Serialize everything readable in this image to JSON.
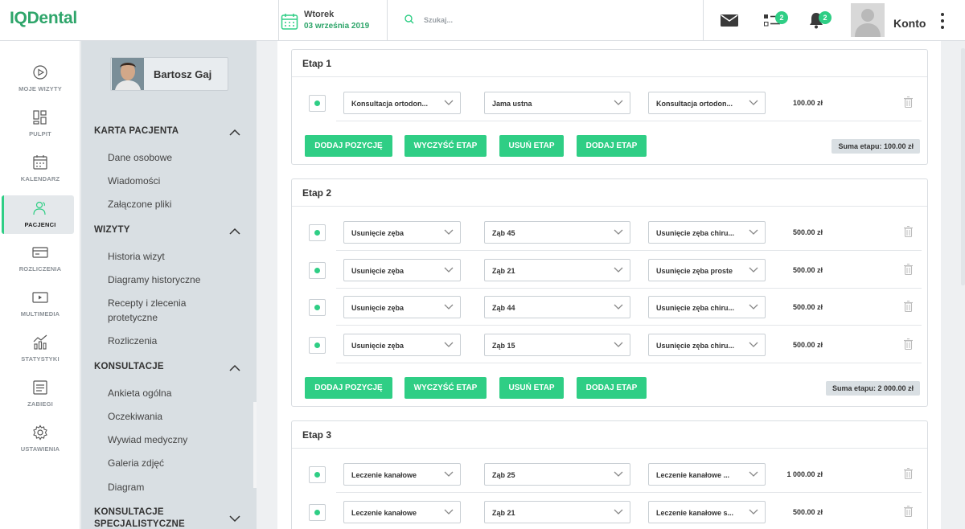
{
  "app": {
    "logo": "IQDental"
  },
  "header": {
    "day": "Wtorek",
    "date": "03 września 2019",
    "search_placeholder": "Szukaj...",
    "tasks_badge": "2",
    "notifications_badge": "2",
    "account_label": "Konto"
  },
  "nav": [
    {
      "label": "MOJE WIZYTY",
      "icon": "play-circle-icon"
    },
    {
      "label": "PULPIT",
      "icon": "dashboard-icon"
    },
    {
      "label": "KALENDARZ",
      "icon": "calendar-icon"
    },
    {
      "label": "PACJENCI",
      "icon": "patients-icon",
      "active": true
    },
    {
      "label": "ROZLICZENIA",
      "icon": "card-icon"
    },
    {
      "label": "MULTIMEDIA",
      "icon": "media-icon"
    },
    {
      "label": "STATYSTYKI",
      "icon": "stats-icon"
    },
    {
      "label": "ZABIEGI",
      "icon": "procedures-icon"
    },
    {
      "label": "USTAWIENIA",
      "icon": "settings-icon"
    }
  ],
  "patient": {
    "name": "Bartosz Gaj",
    "sections": [
      {
        "title": "KARTA PACJENTA",
        "expanded": true,
        "items": [
          "Dane osobowe",
          "Wiadomości",
          "Załączone pliki"
        ]
      },
      {
        "title": "WIZYTY",
        "expanded": true,
        "items": [
          "Historia wizyt",
          "Diagramy historyczne",
          "Recepty i zlecenia",
          "protetyczne",
          "Rozliczenia"
        ]
      },
      {
        "title": "KONSULTACJE",
        "expanded": true,
        "items": [
          "Ankieta ogólna",
          "Oczekiwania",
          "Wywiad medyczny",
          "Galeria zdjęć",
          "Diagram"
        ]
      },
      {
        "title": "KONSULTACJE",
        "title2": "SPECJALISTYCZNE",
        "expanded": false,
        "items": []
      }
    ]
  },
  "buttons": {
    "add_position": "DODAJ POZYCJĘ",
    "clear_stage": "WYCZYŚĆ ETAP",
    "delete_stage": "USUŃ ETAP",
    "add_stage": "DODAJ ETAP"
  },
  "stages": [
    {
      "title": "Etap 1",
      "rows": [
        {
          "service": "Konsultacja ortodon...",
          "area": "Jama ustna",
          "procedure": "Konsultacja ortodon...",
          "price": "100.00 zł"
        }
      ],
      "sum": "Suma etapu: 100.00 zł"
    },
    {
      "title": "Etap 2",
      "rows": [
        {
          "service": "Usunięcie zęba",
          "area": "Ząb 45",
          "procedure": "Usunięcie zęba chiru...",
          "price": "500.00 zł"
        },
        {
          "service": "Usunięcie zęba",
          "area": "Ząb 21",
          "procedure": "Usunięcie zęba proste",
          "price": "500.00 zł"
        },
        {
          "service": "Usunięcie zęba",
          "area": "Ząb 44",
          "procedure": "Usunięcie zęba chiru...",
          "price": "500.00 zł"
        },
        {
          "service": "Usunięcie zęba",
          "area": "Ząb 15",
          "procedure": "Usunięcie zęba chiru...",
          "price": "500.00 zł"
        }
      ],
      "sum": "Suma etapu: 2 000.00 zł"
    },
    {
      "title": "Etap 3",
      "rows": [
        {
          "service": "Leczenie kanałowe",
          "area": "Ząb 25",
          "procedure": "Leczenie kanałowe ...",
          "price": "1 000.00 zł"
        },
        {
          "service": "Leczenie kanałowe",
          "area": "Ząb 21",
          "procedure": "Leczenie kanałowe s...",
          "price": "500.00 zł"
        }
      ],
      "sum": ""
    }
  ],
  "colors": {
    "accent": "#2fce85",
    "brand": "#2ea56a"
  }
}
